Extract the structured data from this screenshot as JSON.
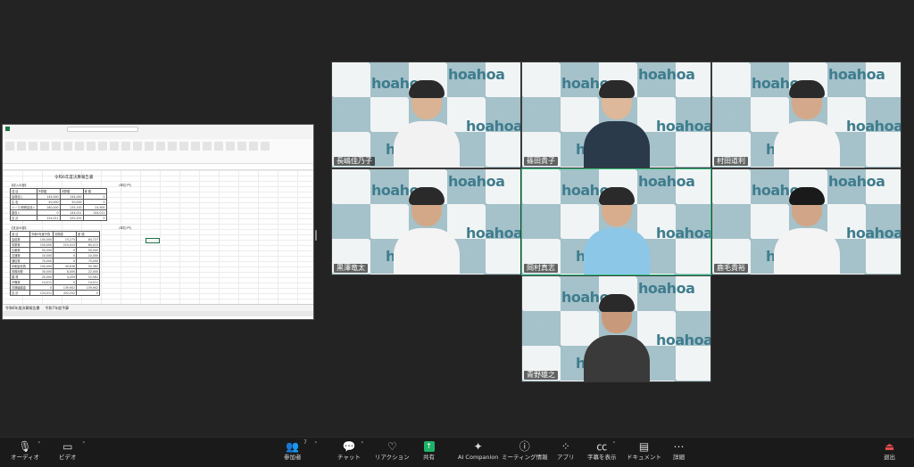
{
  "shared_screen": {
    "sheet_title": "令和6年度決算報告書",
    "income_label": "【収入の部】",
    "expense_label": "【支出の部】",
    "unit_label": "(単位:円)",
    "income_rows": [
      [
        "項 目",
        "予算額",
        "決算額",
        "差 額"
      ],
      [
        "会費収入",
        "144,000",
        "144,000",
        "0"
      ],
      [
        "広 告",
        "50,000",
        "50,000",
        "0"
      ],
      [
        "トーク/研修会収入",
        "160,000",
        "135,100",
        "24,900"
      ],
      [
        "雑収入",
        "0",
        "144,011",
        "144,011"
      ],
      [
        "合 計",
        "124,011",
        "432,252",
        "0"
      ]
    ],
    "expense_rows": [
      [
        "項 目",
        "令和6年度予算",
        "決算額",
        "差 額"
      ],
      [
        "会議費",
        "100,000",
        "15,273",
        "84,727"
      ],
      [
        "事業費",
        "150,000",
        "215,013",
        "65,013"
      ],
      [
        "広報費",
        "50,000",
        "0",
        "50,000"
      ],
      [
        "交通費",
        "10,000",
        "0",
        "10,000"
      ],
      [
        "通信費",
        "70,000",
        "0",
        "70,000"
      ],
      [
        "印刷製本費",
        "100,000",
        "49,638",
        "50,362"
      ],
      [
        "事務用費",
        "30,000",
        "8,000",
        "22,000"
      ],
      [
        "雑 費",
        "20,000",
        "4,439",
        "15,561"
      ],
      [
        "予備費",
        "14,011",
        "0",
        "14,011"
      ],
      [
        "次期繰越金",
        "0",
        "139,902",
        "139,902"
      ],
      [
        "合 計",
        "124,011",
        "432,252",
        "0"
      ]
    ],
    "sheet_tabs": [
      "令和6年度決算報告書",
      "令和7年度予算"
    ]
  },
  "participants": [
    {
      "name": "長嶋佳乃子",
      "shirt": "#f2f2f2",
      "hair": "#2a2a2a",
      "skin": "#d9b394"
    },
    {
      "name": "篠田貴子",
      "shirt": "#2b3a4a",
      "hair": "#2a2a2a",
      "skin": "#ddb89b"
    },
    {
      "name": "村田道利",
      "shirt": "#f4f4f4",
      "hair": "#2a2a2a",
      "skin": "#d4a98b"
    },
    {
      "name": "黒澤竜太",
      "shirt": "#f4f4f4",
      "hair": "#2a2a2a",
      "skin": "#d3a889"
    },
    {
      "name": "岡村真志",
      "shirt": "#8cc7e8",
      "hair": "#2a2a2a",
      "skin": "#d7ad8e"
    },
    {
      "name": "鹿毛貴裕",
      "shirt": "#f4f4f4",
      "hair": "#1a1a1a",
      "skin": "#d1a588"
    },
    {
      "name": "青野雄之",
      "shirt": "#3a3a3a",
      "hair": "#2a2a2a",
      "skin": "#c89a7b"
    }
  ],
  "brand_text": "hoahoa",
  "toolbar": {
    "audio": "オーディオ",
    "video": "ビデオ",
    "participants": "参加者",
    "participants_count": "7",
    "chat": "チャット",
    "reactions": "リアクション",
    "share": "共有",
    "ai": "AI Companion",
    "meeting_info": "ミーティング情報",
    "apps": "アプリ",
    "captions": "字幕を表示",
    "docs": "ドキュメント",
    "more": "詳細",
    "leave": "退出"
  },
  "colors": {
    "active_speaker": "#2ec27e",
    "share_button": "#1fb36a",
    "leave": "#e34a4a"
  }
}
